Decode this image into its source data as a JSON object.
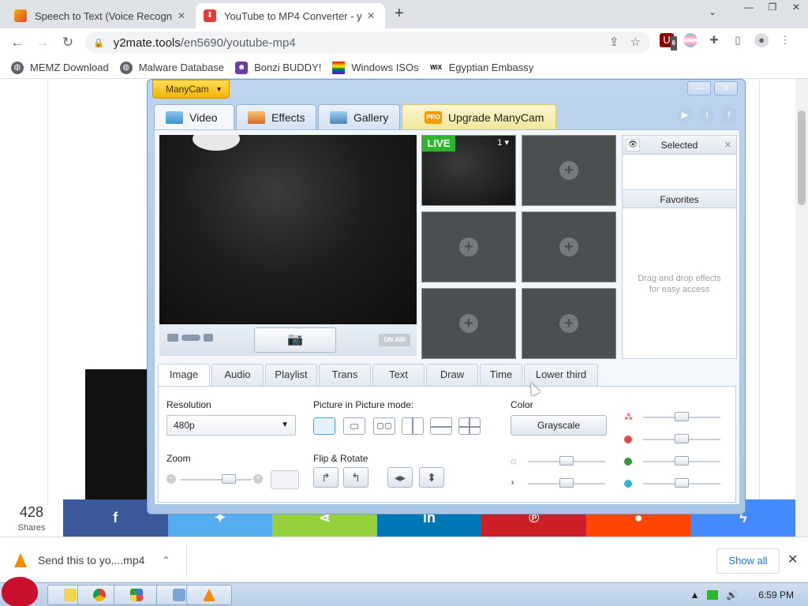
{
  "browser": {
    "tabs": [
      {
        "title": "Speech to Text (Voice Recogn",
        "favicon_color": "#f4b400"
      },
      {
        "title": "YouTube to MP4 Converter - y",
        "favicon_color": "#e53935"
      }
    ],
    "url_domain": "y2mate.tools",
    "url_path": "/en5690/youtube-mp4",
    "extension_badge": "6",
    "bookmarks": [
      {
        "label": "MEMZ Download",
        "icon": "globe-icon"
      },
      {
        "label": "Malware Database",
        "icon": "globe-icon"
      },
      {
        "label": "Bonzi BUDDY!",
        "icon": "purple-figure-icon"
      },
      {
        "label": "Windows ISOs",
        "icon": "rainbow-flag-icon"
      },
      {
        "label": "Egyptian Embassy",
        "icon": "wix-icon"
      }
    ]
  },
  "page": {
    "share_count": "428",
    "share_label": "Shares",
    "share_buttons": [
      {
        "name": "facebook",
        "glyph": "f",
        "color": "#3b5998"
      },
      {
        "name": "twitter",
        "glyph": "🐦",
        "color": "#55acee"
      },
      {
        "name": "share",
        "glyph": "<",
        "color": "#95d03a"
      },
      {
        "name": "linkedin",
        "glyph": "in",
        "color": "#0077b5"
      },
      {
        "name": "pinterest",
        "glyph": "P",
        "color": "#cb2027"
      },
      {
        "name": "reddit",
        "glyph": "●",
        "color": "#ff4500"
      },
      {
        "name": "messenger",
        "glyph": "⚡",
        "color": "#448aff"
      }
    ]
  },
  "download": {
    "filename": "Send this to yo....mp4",
    "show_all": "Show all"
  },
  "taskbar": {
    "clock": "6:59 PM",
    "apps": [
      "explorer-icon",
      "chrome-icon",
      "manycam-icon",
      "control-panel-icon",
      "vlc-icon"
    ]
  },
  "manycam": {
    "menu_label": "ManyCam",
    "tabs": [
      "Video",
      "Effects",
      "Gallery",
      "Upgrade ManyCam"
    ],
    "pro_badge": "PRO",
    "live_label": "LIVE",
    "live_index": "1",
    "on_air": "ON AIR",
    "selected_label": "Selected",
    "favorites_label": "Favorites",
    "favorites_hint": "Drag and drop effects for easy access",
    "subtabs": [
      "Image",
      "Audio",
      "Playlist",
      "Trans",
      "Text",
      "Draw",
      "Time",
      "Lower third"
    ],
    "resolution_label": "Resolution",
    "resolution_value": "480p",
    "pip_label": "Picture in Picture mode:",
    "color_label": "Color",
    "grayscale_label": "Grayscale",
    "zoom_label": "Zoom",
    "flip_label": "Flip & Rotate",
    "accent": "#f3b400",
    "color_dots": [
      "#e84848",
      "#2a9d3a",
      "#34b5d6"
    ]
  }
}
